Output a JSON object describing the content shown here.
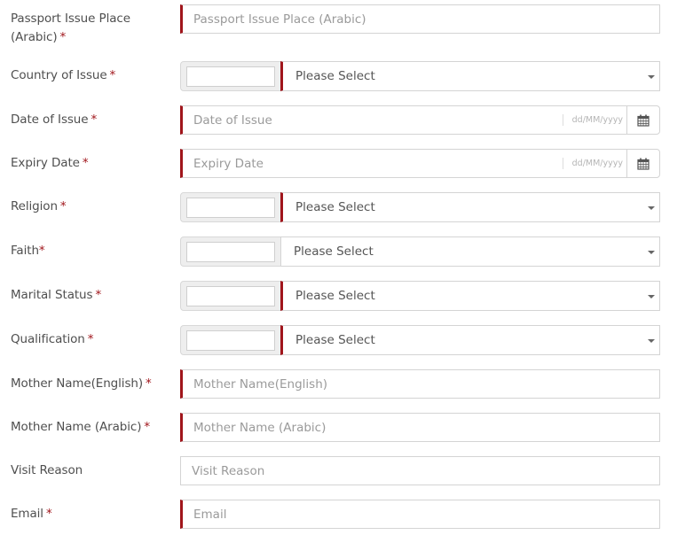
{
  "colors": {
    "required_accent": "#a0151b",
    "border": "#d4d4d4",
    "prefix_bg": "#eeeeee"
  },
  "fields": {
    "passport_issue_place_arabic": {
      "label_line1": "Passport Issue Place",
      "label_line2": "(Arabic)",
      "required_mark": "*",
      "placeholder": "Passport Issue Place (Arabic)",
      "value": ""
    },
    "country_of_issue": {
      "label": "Country of Issue",
      "required_mark": "*",
      "selected": "Please Select",
      "search_value": ""
    },
    "date_of_issue": {
      "label": "Date of Issue",
      "required_mark": "*",
      "placeholder": "Date of Issue",
      "format_hint": "dd/MM/yyyy",
      "icon": "calendar-icon",
      "value": ""
    },
    "expiry_date": {
      "label": "Expiry Date",
      "required_mark": "*",
      "placeholder": "Expiry Date",
      "format_hint": "dd/MM/yyyy",
      "icon": "calendar-icon",
      "value": ""
    },
    "religion": {
      "label": "Religion",
      "required_mark": "*",
      "selected": "Please Select",
      "search_value": ""
    },
    "faith": {
      "label": "Faith",
      "required_mark": "*",
      "selected": "Please Select",
      "search_value": ""
    },
    "marital_status": {
      "label": "Marital Status",
      "required_mark": "*",
      "selected": "Please Select",
      "search_value": ""
    },
    "qualification": {
      "label": "Qualification",
      "required_mark": "*",
      "selected": "Please Select",
      "search_value": ""
    },
    "mother_name_english": {
      "label": "Mother Name(English)",
      "required_mark": "*",
      "placeholder": "Mother Name(English)",
      "value": ""
    },
    "mother_name_arabic": {
      "label": "Mother Name (Arabic)",
      "required_mark": "*",
      "placeholder": "Mother Name (Arabic)",
      "value": ""
    },
    "visit_reason": {
      "label": "Visit Reason",
      "placeholder": "Visit Reason",
      "value": ""
    },
    "email": {
      "label": "Email",
      "required_mark": "*",
      "placeholder": "Email",
      "value": ""
    }
  }
}
